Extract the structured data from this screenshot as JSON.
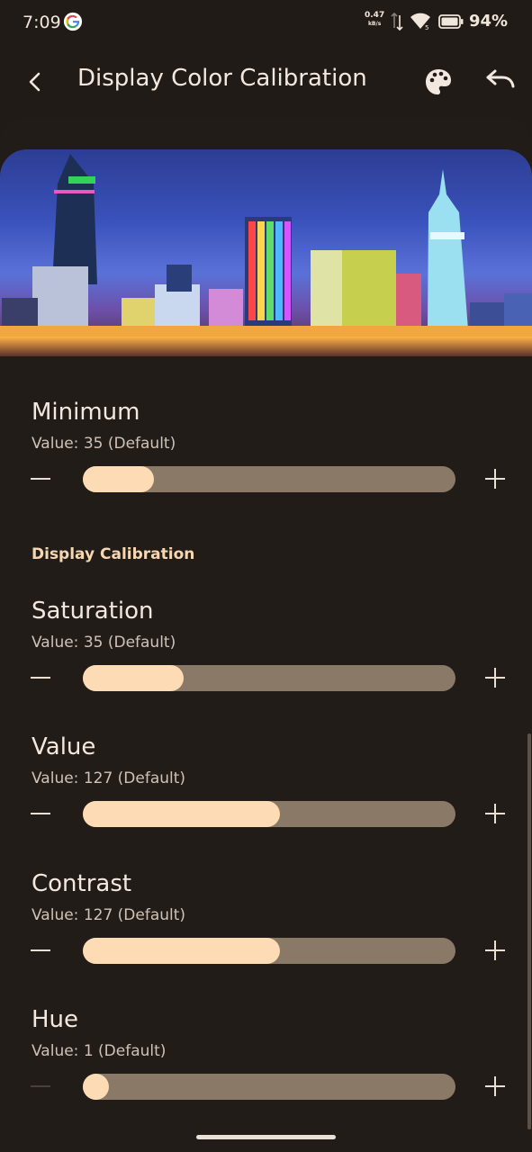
{
  "status_bar": {
    "time": "7:09",
    "net_speed": "0.47",
    "net_unit": "kB/s",
    "battery_pct": "94%"
  },
  "app_bar": {
    "title": "Display Color Calibration",
    "back_icon": "back-arrow-icon",
    "palette_icon": "palette-icon",
    "undo_icon": "undo-icon"
  },
  "minimum": {
    "title": "Minimum",
    "value_text": "Value: 35 (Default)",
    "fraction": 0.19
  },
  "section": {
    "header": "Display Calibration"
  },
  "saturation": {
    "title": "Saturation",
    "value_text": "Value: 35 (Default)",
    "fraction": 0.27
  },
  "value": {
    "title": "Value",
    "value_text": "Value: 127 (Default)",
    "fraction": 0.53
  },
  "contrast": {
    "title": "Contrast",
    "value_text": "Value: 127 (Default)",
    "fraction": 0.53
  },
  "hue": {
    "title": "Hue",
    "value_text": "Value: 1 (Default)",
    "fraction": 0.07
  },
  "colors": {
    "background": "#201b17",
    "track": "#8b7967",
    "fill": "#fddcb5",
    "accent_header": "#f6d7b3"
  }
}
